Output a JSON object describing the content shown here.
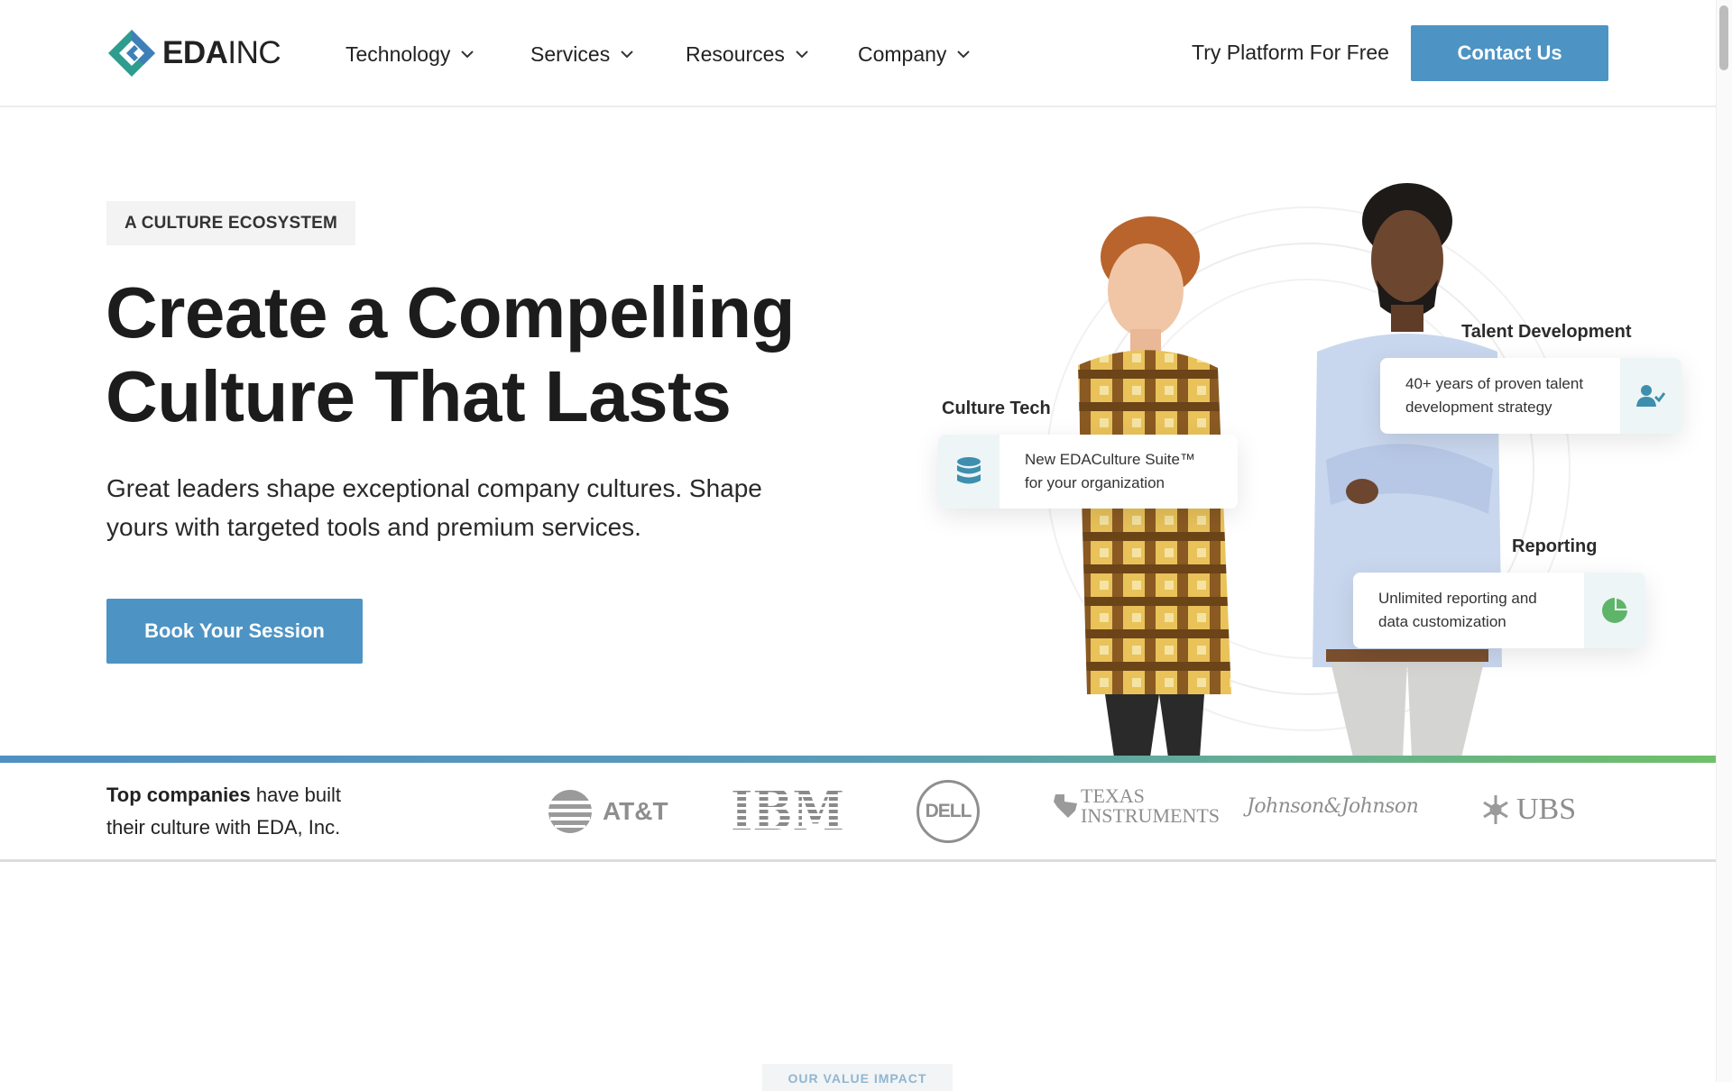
{
  "header": {
    "logo": {
      "brand": "EDA",
      "suffix": "INC"
    },
    "nav": [
      {
        "label": "Technology"
      },
      {
        "label": "Services"
      },
      {
        "label": "Resources"
      },
      {
        "label": "Company"
      }
    ],
    "try_label": "Try Platform For Free",
    "contact_label": "Contact Us"
  },
  "hero": {
    "eyebrow": "A CULTURE ECOSYSTEM",
    "title_line1": "Create a Compelling",
    "title_line2": "Culture That Lasts",
    "subtitle": "Great leaders shape exceptional company cultures. Shape yours with targeted tools and premium services.",
    "cta_label": "Book Your Session"
  },
  "callouts": {
    "culture_tech": {
      "title": "Culture Tech",
      "line1": "New EDACulture Suite™",
      "line2": "for your organization",
      "icon": "database-icon"
    },
    "talent": {
      "title": "Talent Development",
      "line1": "40+ years of proven talent",
      "line2": "development strategy",
      "icon": "user-check-icon"
    },
    "reporting": {
      "title": "Reporting",
      "line1": "Unlimited reporting and",
      "line2": "data customization",
      "icon": "pie-chart-icon"
    }
  },
  "clients": {
    "lead_bold": "Top companies",
    "lead_rest": " have built",
    "lead_line2": "their culture with EDA, Inc.",
    "logos": [
      "AT&T",
      "IBM",
      "DELL",
      "TEXAS",
      "INSTRUMENTS",
      "Johnson&Johnson",
      "UBS"
    ]
  },
  "value_tag": "OUR VALUE IMPACT",
  "colors": {
    "accent": "#4d94c4",
    "logo_teal": "#2b8f8a",
    "logo_blue": "#3f7fb8",
    "green": "#6fc06a"
  }
}
